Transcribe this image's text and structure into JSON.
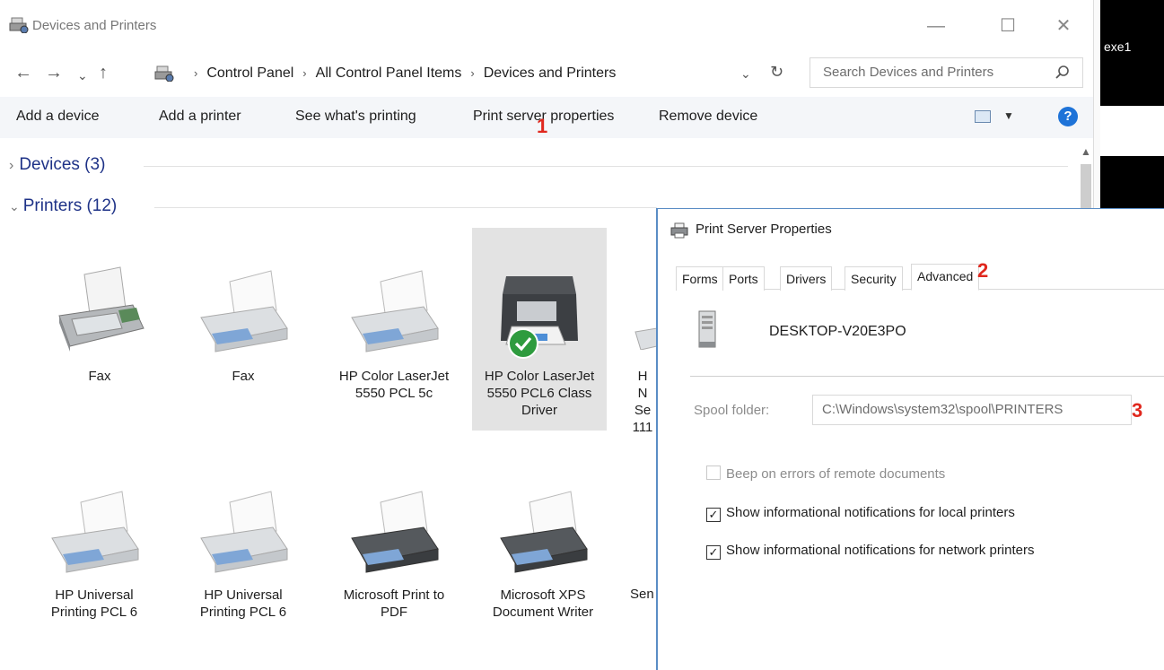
{
  "window": {
    "title": "Devices and Printers",
    "controls": {
      "minimize": "—",
      "maximize": "☐",
      "close": "✕"
    }
  },
  "side_text": "exe1",
  "address": {
    "crumbs": [
      "Control Panel",
      "All Control Panel Items",
      "Devices and Printers"
    ],
    "search_placeholder": "Search Devices and Printers"
  },
  "toolbar": {
    "items": [
      "Add a device",
      "Add a printer",
      "See what's printing",
      "Print server properties",
      "Remove device"
    ],
    "help": "?"
  },
  "annotations": {
    "one": "1",
    "two": "2",
    "three": "3"
  },
  "groups": {
    "devices": "Devices (3)",
    "printers": "Printers (12)"
  },
  "printers": [
    {
      "line1": "Fax",
      "line2": "",
      "line3": ""
    },
    {
      "line1": "Fax",
      "line2": "",
      "line3": ""
    },
    {
      "line1": "HP Color LaserJet",
      "line2": "5550 PCL 5c",
      "line3": ""
    },
    {
      "line1": "HP Color LaserJet",
      "line2": "5550 PCL6 Class",
      "line3": "Driver"
    },
    {
      "line1": "HP Universal",
      "line2": "Printing PCL 6",
      "line3": ""
    },
    {
      "line1": "HP Universal",
      "line2": "Printing PCL 6",
      "line3": ""
    },
    {
      "line1": "Microsoft Print to",
      "line2": "PDF",
      "line3": ""
    },
    {
      "line1": "Microsoft XPS",
      "line2": "Document Writer",
      "line3": ""
    }
  ],
  "partial_items": {
    "row1": [
      "H",
      "N",
      "Se",
      "111"
    ],
    "row2": "Sen"
  },
  "dialog": {
    "title": "Print Server Properties",
    "tabs": [
      "Forms",
      "Ports",
      "Drivers",
      "Security",
      "Advanced"
    ],
    "active_tab": "Advanced",
    "server_name": "DESKTOP-V20E3PO",
    "spool_label": "Spool folder:",
    "spool_value": "C:\\Windows\\system32\\spool\\PRINTERS",
    "checkboxes": [
      {
        "label": "Beep on errors of remote documents",
        "checked": false,
        "enabled": false
      },
      {
        "label": "Show informational notifications for local printers",
        "checked": true,
        "enabled": true
      },
      {
        "label": "Show informational notifications for network printers",
        "checked": true,
        "enabled": true
      }
    ]
  },
  "colors": {
    "accent": "#1e3287",
    "annotation": "#e0281e",
    "selection": "#e3e3e3",
    "help": "#1e73d8"
  }
}
